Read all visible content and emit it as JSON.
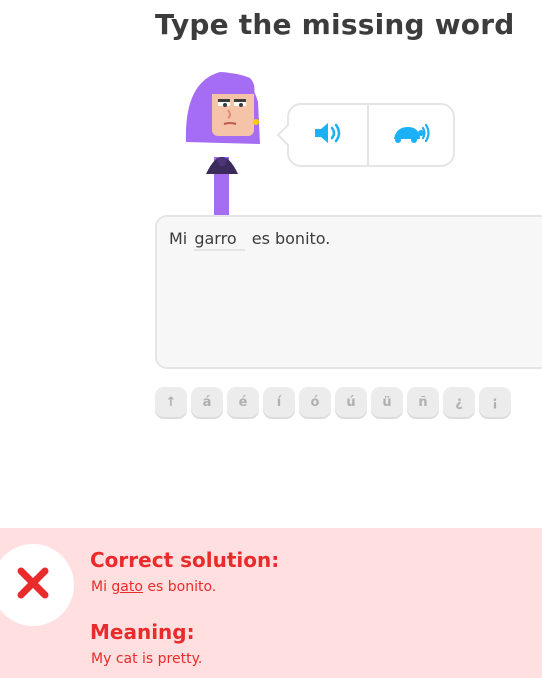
{
  "challenge": {
    "title": "Type the missing word"
  },
  "speech": {
    "normal_icon": "speaker-icon",
    "slow_icon": "turtle-speaker-icon",
    "accent_color": "#1cb0f6"
  },
  "sentence": {
    "before": "Mi",
    "typed_word": "garro",
    "after": "es bonito."
  },
  "keyboard": {
    "keys": [
      "↑",
      "á",
      "é",
      "í",
      "ó",
      "ú",
      "ü",
      "ñ",
      "¿",
      "¡"
    ]
  },
  "feedback": {
    "status_icon": "x-icon",
    "status_color": "#ea2b2b",
    "background_color": "#ffdfe0",
    "solution_heading": "Correct solution:",
    "solution": {
      "before": "Mi",
      "highlight": "gato",
      "after": "es bonito."
    },
    "meaning_heading": "Meaning:",
    "meaning_text": "My cat is pretty."
  }
}
